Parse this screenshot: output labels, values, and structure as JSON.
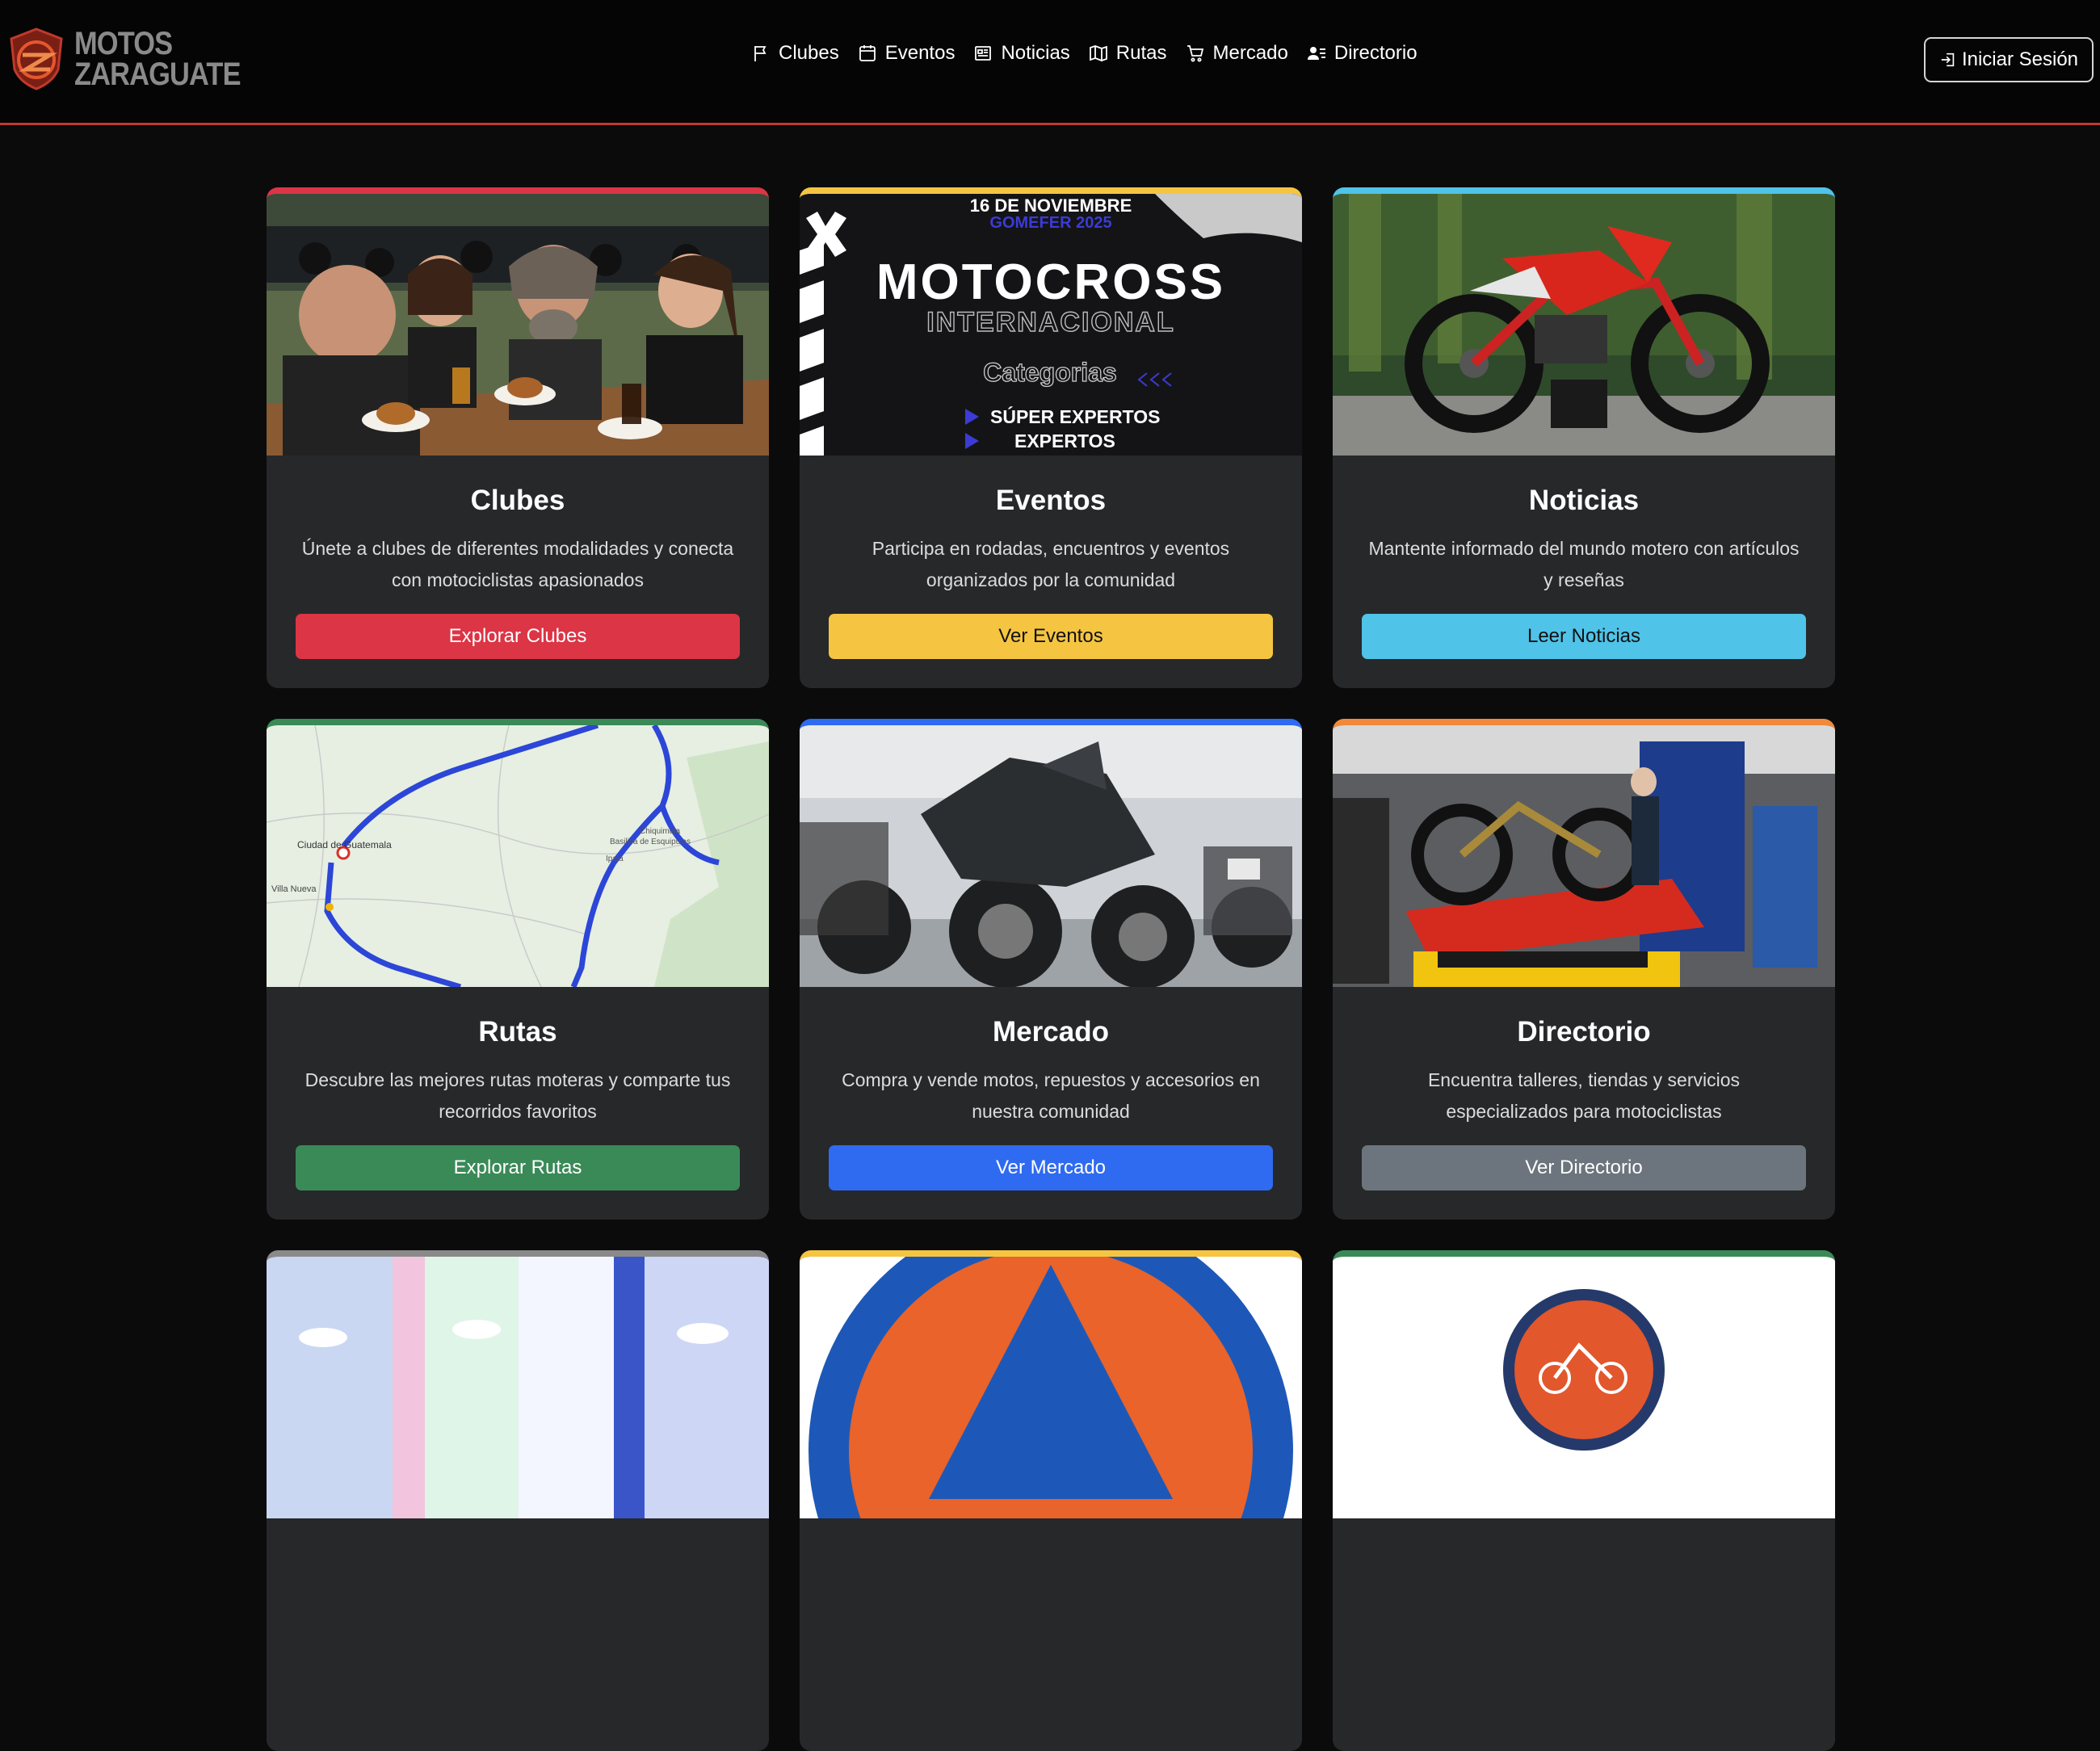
{
  "brand": {
    "line1": "MOTOS",
    "line2": "ZARAGUATE",
    "logo_icon": "moto-club-shield-icon"
  },
  "nav": {
    "items": [
      {
        "label": "Clubes",
        "icon": "flag-icon"
      },
      {
        "label": "Eventos",
        "icon": "calendar-icon"
      },
      {
        "label": "Noticias",
        "icon": "newspaper-icon"
      },
      {
        "label": "Rutas",
        "icon": "map-icon"
      },
      {
        "label": "Mercado",
        "icon": "cart-icon"
      },
      {
        "label": "Directorio",
        "icon": "people-list-icon"
      }
    ],
    "login": "Iniciar Sesión"
  },
  "colors": {
    "accent": "#c0392b",
    "red": "#dc3545",
    "yellow": "#f5c542",
    "cyan": "#4fc3e8",
    "green": "#3a8a57",
    "blue": "#2f6bf0",
    "gray": "#6c757d"
  },
  "cards": [
    {
      "title": "Clubes",
      "text": "Únete a clubes de diferentes modalidades y conecta con motociclistas apasionados",
      "button": "Explorar Clubes"
    },
    {
      "title": "Eventos",
      "text": "Participa en rodadas, encuentros y eventos organizados por la comunidad",
      "button": "Ver Eventos",
      "image_text": {
        "date": "16 DE NOVIEMBRE",
        "place": "GOMEFER 2025",
        "title": "MOTOCROSS",
        "subtitle": "INTERNACIONAL",
        "cats": "Categorias",
        "cat1": "SÚPER EXPERTOS",
        "cat2": "EXPERTOS"
      }
    },
    {
      "title": "Noticias",
      "text": "Mantente informado del mundo motero con artículos y reseñas",
      "button": "Leer Noticias"
    },
    {
      "title": "Rutas",
      "text": "Descubre las mejores rutas moteras y comparte tus recorridos favoritos",
      "button": "Explorar Rutas",
      "map_labels": {
        "city": "Ciudad de Guatemala",
        "town": "Villa Nueva",
        "east": "Basilica de Esquipulas",
        "mid": "Ipala",
        "north": "Chiquimula"
      }
    },
    {
      "title": "Mercado",
      "text": "Compra y vende motos, repuestos y accesorios en nuestra comunidad",
      "button": "Ver Mercado"
    },
    {
      "title": "Directorio",
      "text": "Encuentra talleres, tiendas y servicios especializados para motociclistas",
      "button": "Ver Directorio"
    }
  ]
}
